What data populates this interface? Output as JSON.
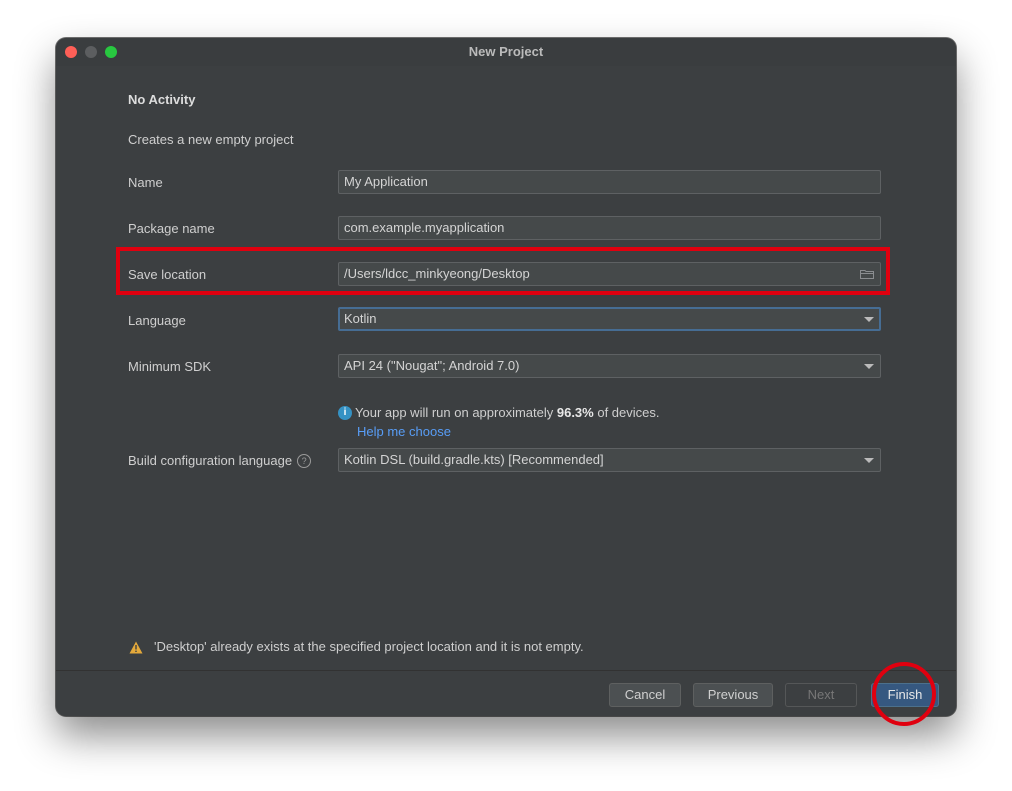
{
  "window": {
    "title": "New Project"
  },
  "template": {
    "heading": "No Activity",
    "description": "Creates a new empty project"
  },
  "form": {
    "name": {
      "label": "Name",
      "value": "My Application"
    },
    "package_name": {
      "label": "Package name",
      "value": "com.example.myapplication"
    },
    "save_location": {
      "label": "Save location",
      "value": "/Users/ldcc_minkyeong/Desktop"
    },
    "language": {
      "label": "Language",
      "value": "Kotlin"
    },
    "minimum_sdk": {
      "label": "Minimum SDK",
      "value": "API 24 (\"Nougat\"; Android 7.0)"
    },
    "build_config_language": {
      "label": "Build configuration language",
      "value": "Kotlin DSL (build.gradle.kts) [Recommended]"
    }
  },
  "sdk_info": {
    "prefix": "Your app will run on approximately ",
    "percent": "96.3%",
    "suffix": " of devices.",
    "help_link": "Help me choose"
  },
  "warning": {
    "text": "'Desktop' already exists at the specified project location and it is not empty."
  },
  "buttons": {
    "cancel": "Cancel",
    "previous": "Previous",
    "next": "Next",
    "finish": "Finish"
  },
  "icons": {
    "info": "info-icon",
    "help": "question-mark-icon",
    "warning": "warning-triangle-icon",
    "folder": "folder-icon",
    "dropdown": "chevron-down-icon"
  },
  "colors": {
    "window_bg": "#3c3f41",
    "field_bg": "#45494a",
    "focus_border": "#466d94",
    "primary_button": "#365880",
    "link": "#589df6",
    "info_icon": "#3592c4",
    "warning_icon": "#e4a93b",
    "annotation_red": "#e0000f"
  }
}
